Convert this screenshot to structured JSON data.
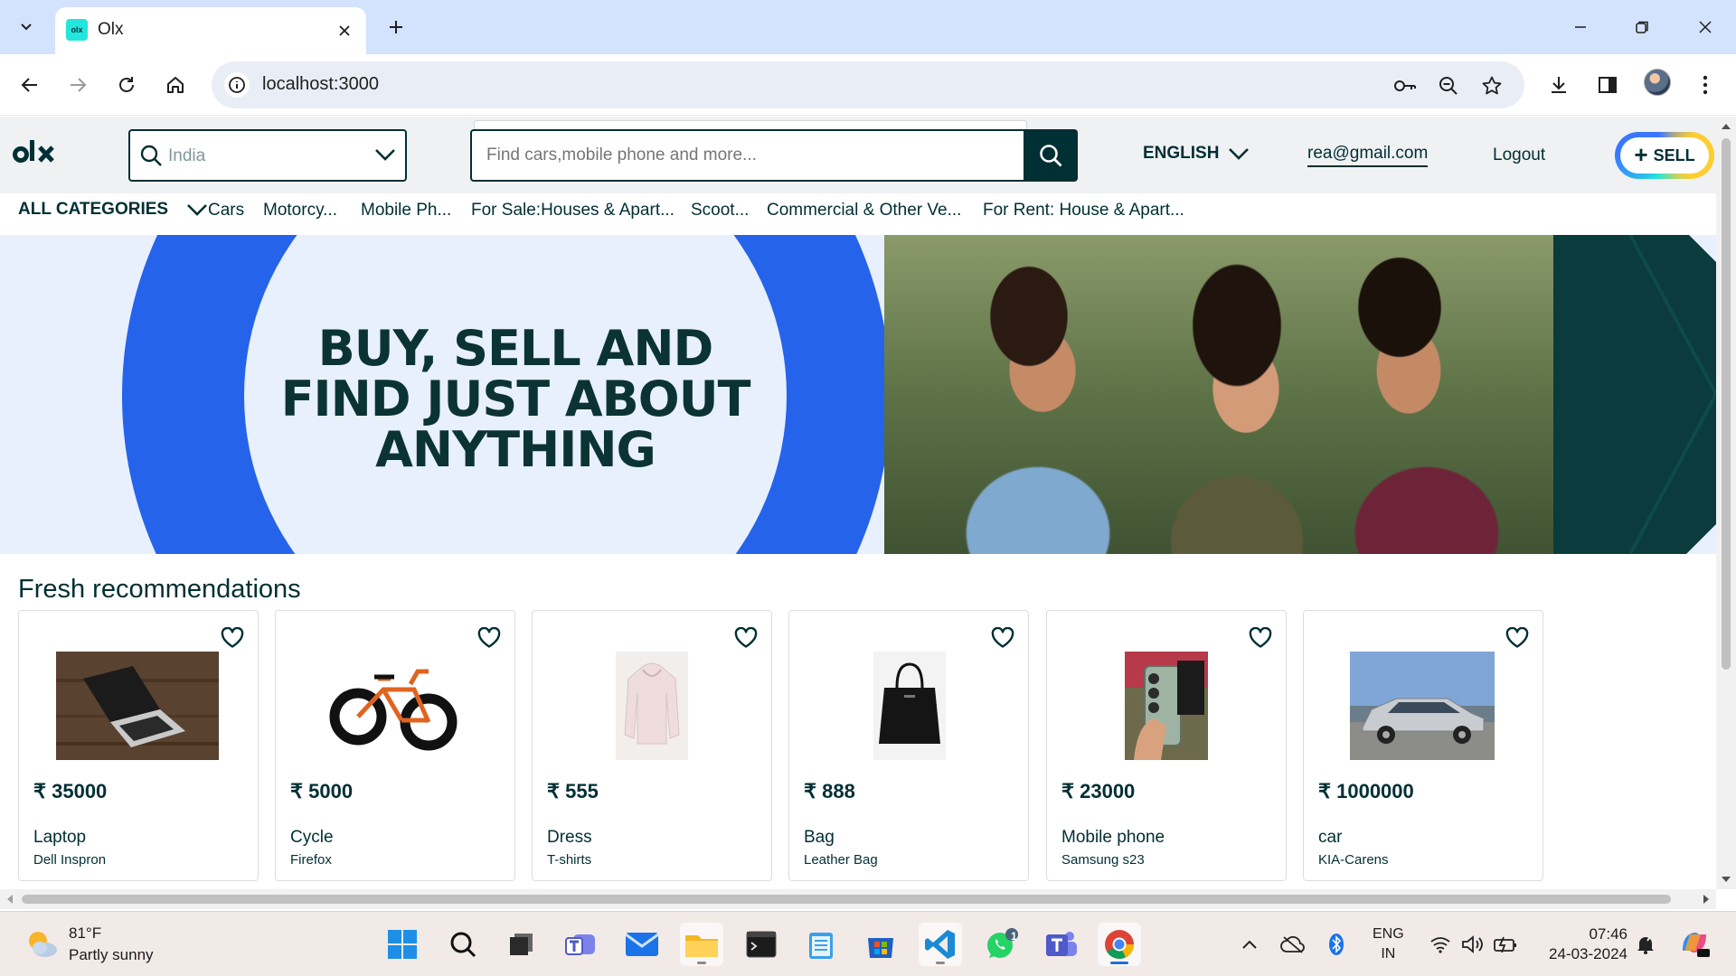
{
  "browser": {
    "tab": {
      "title": "Olx",
      "favicon_text": "olx"
    },
    "url": "localhost:3000"
  },
  "header": {
    "location": {
      "value": "India"
    },
    "search": {
      "placeholder": "Find cars,mobile phone and more..."
    },
    "language": "ENGLISH",
    "user_email": "rea@gmail.com",
    "logout_label": "Logout",
    "sell_label": "SELL"
  },
  "categories": {
    "all_label": "ALL CATEGORIES",
    "items": [
      "Cars",
      "Motorcy...",
      "Mobile Ph...",
      "For Sale:Houses & Apart...",
      "Scoot...",
      "Commercial & Other Ve...",
      "For Rent: House & Apart..."
    ]
  },
  "banner": {
    "line1": "BUY, SELL AND",
    "line2": "FIND JUST ABOUT",
    "line3": "ANYTHING"
  },
  "recommendations": {
    "title": "Fresh recommendations",
    "products": [
      {
        "price": "₹ 35000",
        "name": "Laptop",
        "subtitle": "Dell Inspron",
        "image": "laptop"
      },
      {
        "price": "₹ 5000",
        "name": "Cycle",
        "subtitle": "Firefox",
        "image": "cycle"
      },
      {
        "price": "₹ 555",
        "name": "Dress",
        "subtitle": "T-shirts",
        "image": "hoodie"
      },
      {
        "price": "₹ 888",
        "name": "Bag",
        "subtitle": "Leather Bag",
        "image": "bag"
      },
      {
        "price": "₹ 23000",
        "name": "Mobile phone",
        "subtitle": "Samsung s23",
        "image": "phone"
      },
      {
        "price": "₹ 1000000",
        "name": "car",
        "subtitle": "KIA-Carens",
        "image": "car"
      }
    ]
  },
  "taskbar": {
    "weather": {
      "temp": "81°F",
      "desc": "Partly sunny"
    },
    "language": {
      "line1": "ENG",
      "line2": "IN"
    },
    "clock": {
      "time": "07:46",
      "date": "24-03-2024"
    },
    "whatsapp_badge": "1"
  },
  "colors": {
    "olx_dark": "#002f34",
    "tab_strip": "#d3e3fd",
    "banner_blue": "#2563eb",
    "banner_bg": "#e8f0fd"
  }
}
